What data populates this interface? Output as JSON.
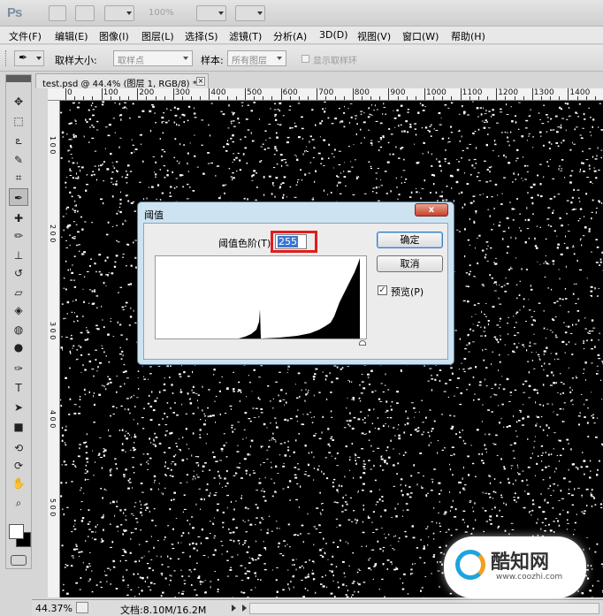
{
  "app": {
    "logo": "Ps",
    "zoom_display": "100%"
  },
  "menu": [
    "文件(F)",
    "编辑(E)",
    "图像(I)",
    "图层(L)",
    "选择(S)",
    "滤镜(T)",
    "分析(A)",
    "3D(D)",
    "视图(V)",
    "窗口(W)",
    "帮助(H)"
  ],
  "options_bar": {
    "sample_size_label": "取样大小:",
    "sample_size_value": "取样点",
    "sample_label": "样本:",
    "sample_value": "所有图层",
    "show_ring_label": "显示取样环",
    "show_ring_checked": false
  },
  "document_tab": {
    "title": "test.psd @ 44.4% (图层 1, RGB/8) *",
    "close": "×"
  },
  "ruler": {
    "labels": [
      "0",
      "100",
      "200",
      "300",
      "400",
      "500",
      "600",
      "700",
      "800",
      "900",
      "1000",
      "1100",
      "1200",
      "1300",
      "1400"
    ]
  },
  "tools": [
    {
      "name": "move-tool-icon",
      "glyph": "✥"
    },
    {
      "name": "marquee-tool-icon",
      "glyph": "⬚"
    },
    {
      "name": "lasso-tool-icon",
      "glyph": "ఽ"
    },
    {
      "name": "quick-select-tool-icon",
      "glyph": "✎"
    },
    {
      "name": "crop-tool-icon",
      "glyph": "⌗"
    },
    {
      "name": "eyedropper-tool-icon",
      "glyph": "✒"
    },
    {
      "name": "healing-brush-tool-icon",
      "glyph": "✚"
    },
    {
      "name": "brush-tool-icon",
      "glyph": "✏"
    },
    {
      "name": "clone-stamp-tool-icon",
      "glyph": "⊥"
    },
    {
      "name": "history-brush-tool-icon",
      "glyph": "↺"
    },
    {
      "name": "eraser-tool-icon",
      "glyph": "▱"
    },
    {
      "name": "paint-bucket-tool-icon",
      "glyph": "◈"
    },
    {
      "name": "blur-tool-icon",
      "glyph": "◍"
    },
    {
      "name": "dodge-tool-icon",
      "glyph": "●"
    },
    {
      "name": "pen-tool-icon",
      "glyph": "✑"
    },
    {
      "name": "type-tool-icon",
      "glyph": "T"
    },
    {
      "name": "path-select-tool-icon",
      "glyph": "➤"
    },
    {
      "name": "shape-tool-icon",
      "glyph": "■"
    },
    {
      "name": "3d-rotate-tool-icon",
      "glyph": "⟲"
    },
    {
      "name": "3d-orbit-tool-icon",
      "glyph": "⟳"
    },
    {
      "name": "hand-tool-icon",
      "glyph": "✋"
    },
    {
      "name": "zoom-tool-icon",
      "glyph": "⌕"
    }
  ],
  "active_tool": "eyedropper-tool-icon",
  "dialog": {
    "title": "阈值",
    "close": "x",
    "level_label": "阈值色阶(T):",
    "level_value": "255",
    "ok_label": "确定",
    "cancel_label": "取消",
    "preview_label": "预览(P)",
    "preview_checked": true
  },
  "status": {
    "zoom": "44.37%",
    "doc_size": "文档:8.10M/16.2M"
  },
  "watermark": {
    "text": "酷知网",
    "url": "www.coozhi.com"
  },
  "colors": {
    "canvas": "#000000",
    "noise": "#ffffff",
    "highlight": "#e51a1a",
    "selection": "#3a76d0"
  }
}
